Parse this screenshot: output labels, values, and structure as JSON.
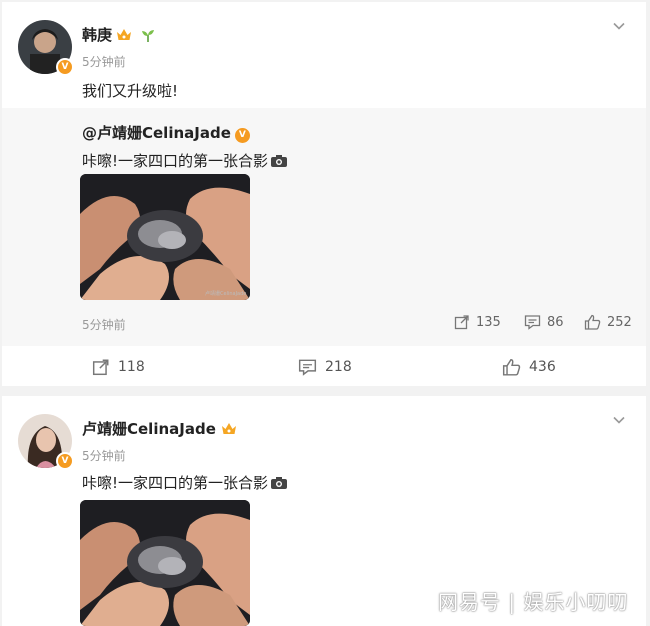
{
  "post1": {
    "user": "韩庚",
    "time": "5分钟前",
    "text": "我们又升级啦!",
    "repost": {
      "author": "@卢靖姗CelinaJade",
      "text": "咔嚓!一家四口的第一张合影",
      "time": "5分钟前",
      "shares": "135",
      "comments": "86",
      "likes": "252"
    },
    "shares": "118",
    "comments": "218",
    "likes": "436"
  },
  "post2": {
    "user": "卢靖姗CelinaJade",
    "time": "5分钟前",
    "text": "咔嚓!一家四口的第一张合影"
  },
  "watermark": "网易号 | 娱乐小叨叨",
  "colors": {
    "badge": "#f59b21",
    "repost_bg": "#f7f7f7",
    "page_bg": "#f2f2f2"
  }
}
